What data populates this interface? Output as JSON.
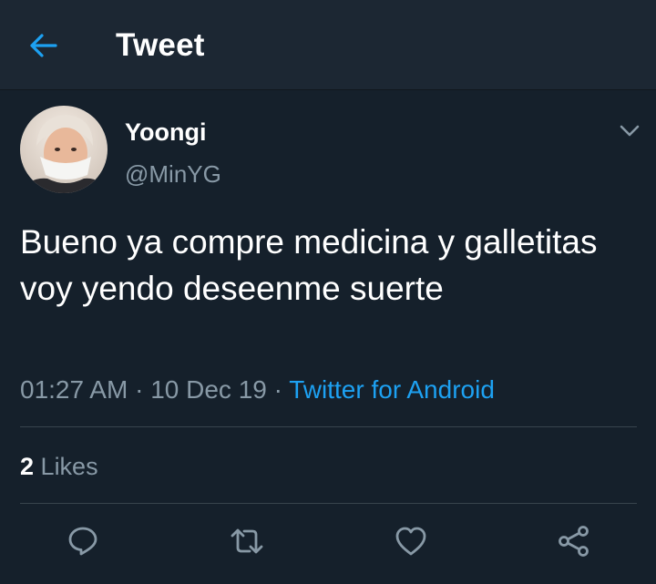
{
  "header": {
    "title": "Tweet",
    "back_icon": "arrow-left-icon"
  },
  "tweet": {
    "display_name": "Yoongi",
    "handle": "@MinYG",
    "text": "Bueno ya compre medicina y galletitas voy yendo deseenme suerte",
    "time": "01:27 AM",
    "date": "10 Dec 19",
    "source": "Twitter for Android",
    "likes_count": "2",
    "likes_label": "Likes"
  },
  "actions": [
    {
      "name": "reply",
      "icon": "reply-icon"
    },
    {
      "name": "retweet",
      "icon": "retweet-icon"
    },
    {
      "name": "like",
      "icon": "heart-icon"
    },
    {
      "name": "share",
      "icon": "share-icon"
    }
  ],
  "colors": {
    "background": "#15202b",
    "header": "#1c2733",
    "accent": "#1da1f2",
    "secondary_text": "#8899a6",
    "divider": "#38444d"
  }
}
